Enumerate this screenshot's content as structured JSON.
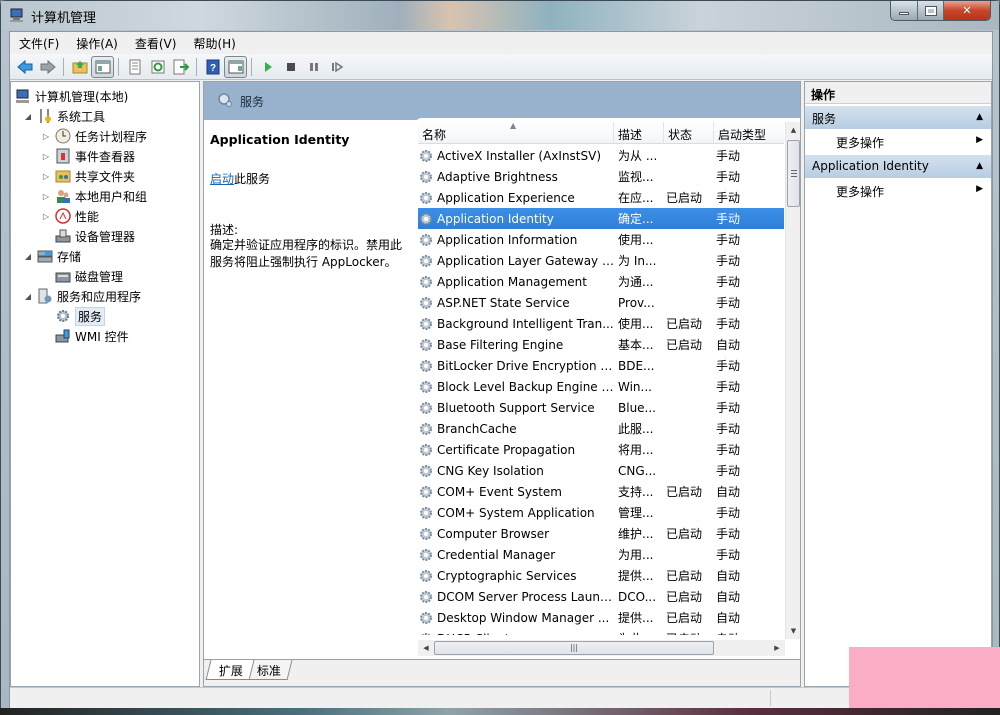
{
  "window": {
    "title": "计算机管理",
    "controls": {
      "minimize": "—",
      "maximize": "□",
      "close": "✕"
    }
  },
  "menu": [
    "文件(F)",
    "操作(A)",
    "查看(V)",
    "帮助(H)"
  ],
  "toolbar": {
    "buttons": [
      "back-icon",
      "forward-icon",
      "up-folder-icon",
      "show-hide-tree-icon",
      "properties-icon",
      "refresh-icon",
      "export-list-icon",
      "help-icon",
      "show-hide-action-pane-icon",
      "start-service-icon",
      "stop-service-icon",
      "pause-service-icon",
      "restart-service-icon"
    ]
  },
  "tree": {
    "root": "计算机管理(本地)",
    "groups": [
      {
        "label": "系统工具",
        "children": [
          "任务计划程序",
          "事件查看器",
          "共享文件夹",
          "本地用户和组",
          "性能",
          "设备管理器"
        ]
      },
      {
        "label": "存储",
        "children": [
          "磁盘管理"
        ]
      },
      {
        "label": "服务和应用程序",
        "children": [
          "服务",
          "WMI 控件"
        ]
      }
    ],
    "selected": "服务"
  },
  "middle": {
    "header_title": "服务",
    "detail": {
      "service_name": "Application Identity",
      "start_link": "启动",
      "start_suffix": "此服务",
      "desc_label": "描述:",
      "description": "确定并验证应用程序的标识。禁用此服务将阻止强制执行 AppLocker。"
    },
    "columns": {
      "name": "名称",
      "desc": "描述",
      "status": "状态",
      "startup": "启动类型"
    },
    "services": [
      {
        "name": "ActiveX Installer (AxInstSV)",
        "desc": "为从 ...",
        "status": "",
        "startup": "手动"
      },
      {
        "name": "Adaptive Brightness",
        "desc": "监视...",
        "status": "",
        "startup": "手动"
      },
      {
        "name": "Application Experience",
        "desc": "在应...",
        "status": "已启动",
        "startup": "手动"
      },
      {
        "name": "Application Identity",
        "desc": "确定...",
        "status": "",
        "startup": "手动",
        "selected": true
      },
      {
        "name": "Application Information",
        "desc": "使用...",
        "status": "",
        "startup": "手动"
      },
      {
        "name": "Application Layer Gateway S...",
        "desc": "为 In...",
        "status": "",
        "startup": "手动"
      },
      {
        "name": "Application Management",
        "desc": "为通...",
        "status": "",
        "startup": "手动"
      },
      {
        "name": "ASP.NET State Service",
        "desc": "Prov...",
        "status": "",
        "startup": "手动"
      },
      {
        "name": "Background Intelligent Tran...",
        "desc": "使用...",
        "status": "已启动",
        "startup": "手动"
      },
      {
        "name": "Base Filtering Engine",
        "desc": "基本...",
        "status": "已启动",
        "startup": "自动"
      },
      {
        "name": "BitLocker Drive Encryption S...",
        "desc": "BDE...",
        "status": "",
        "startup": "手动"
      },
      {
        "name": "Block Level Backup Engine S...",
        "desc": "Win...",
        "status": "",
        "startup": "手动"
      },
      {
        "name": "Bluetooth Support Service",
        "desc": "Blue...",
        "status": "",
        "startup": "手动"
      },
      {
        "name": "BranchCache",
        "desc": "此服...",
        "status": "",
        "startup": "手动"
      },
      {
        "name": "Certificate Propagation",
        "desc": "将用...",
        "status": "",
        "startup": "手动"
      },
      {
        "name": "CNG Key Isolation",
        "desc": "CNG...",
        "status": "",
        "startup": "手动"
      },
      {
        "name": "COM+ Event System",
        "desc": "支持...",
        "status": "已启动",
        "startup": "自动"
      },
      {
        "name": "COM+ System Application",
        "desc": "管理...",
        "status": "",
        "startup": "手动"
      },
      {
        "name": "Computer Browser",
        "desc": "维护...",
        "status": "已启动",
        "startup": "手动"
      },
      {
        "name": "Credential Manager",
        "desc": "为用...",
        "status": "",
        "startup": "手动"
      },
      {
        "name": "Cryptographic Services",
        "desc": "提供...",
        "status": "已启动",
        "startup": "自动"
      },
      {
        "name": "DCOM Server Process Launc...",
        "desc": "DCO...",
        "status": "已启动",
        "startup": "自动"
      },
      {
        "name": "Desktop Window Manager ...",
        "desc": "提供...",
        "status": "已启动",
        "startup": "自动"
      },
      {
        "name": "DHCP Client",
        "desc": "为此...",
        "status": "已启动",
        "startup": "自动"
      }
    ],
    "tabs": [
      "扩展",
      "标准"
    ],
    "active_tab": "扩展"
  },
  "actions": {
    "header": "操作",
    "sections": [
      {
        "title": "服务",
        "item": "更多操作"
      },
      {
        "title": "Application Identity",
        "item": "更多操作"
      }
    ]
  },
  "colors": {
    "selection": "#3385e0",
    "header_band": "#98b2cd",
    "action_section": "#c3d5e8",
    "link": "#1a63b8"
  }
}
